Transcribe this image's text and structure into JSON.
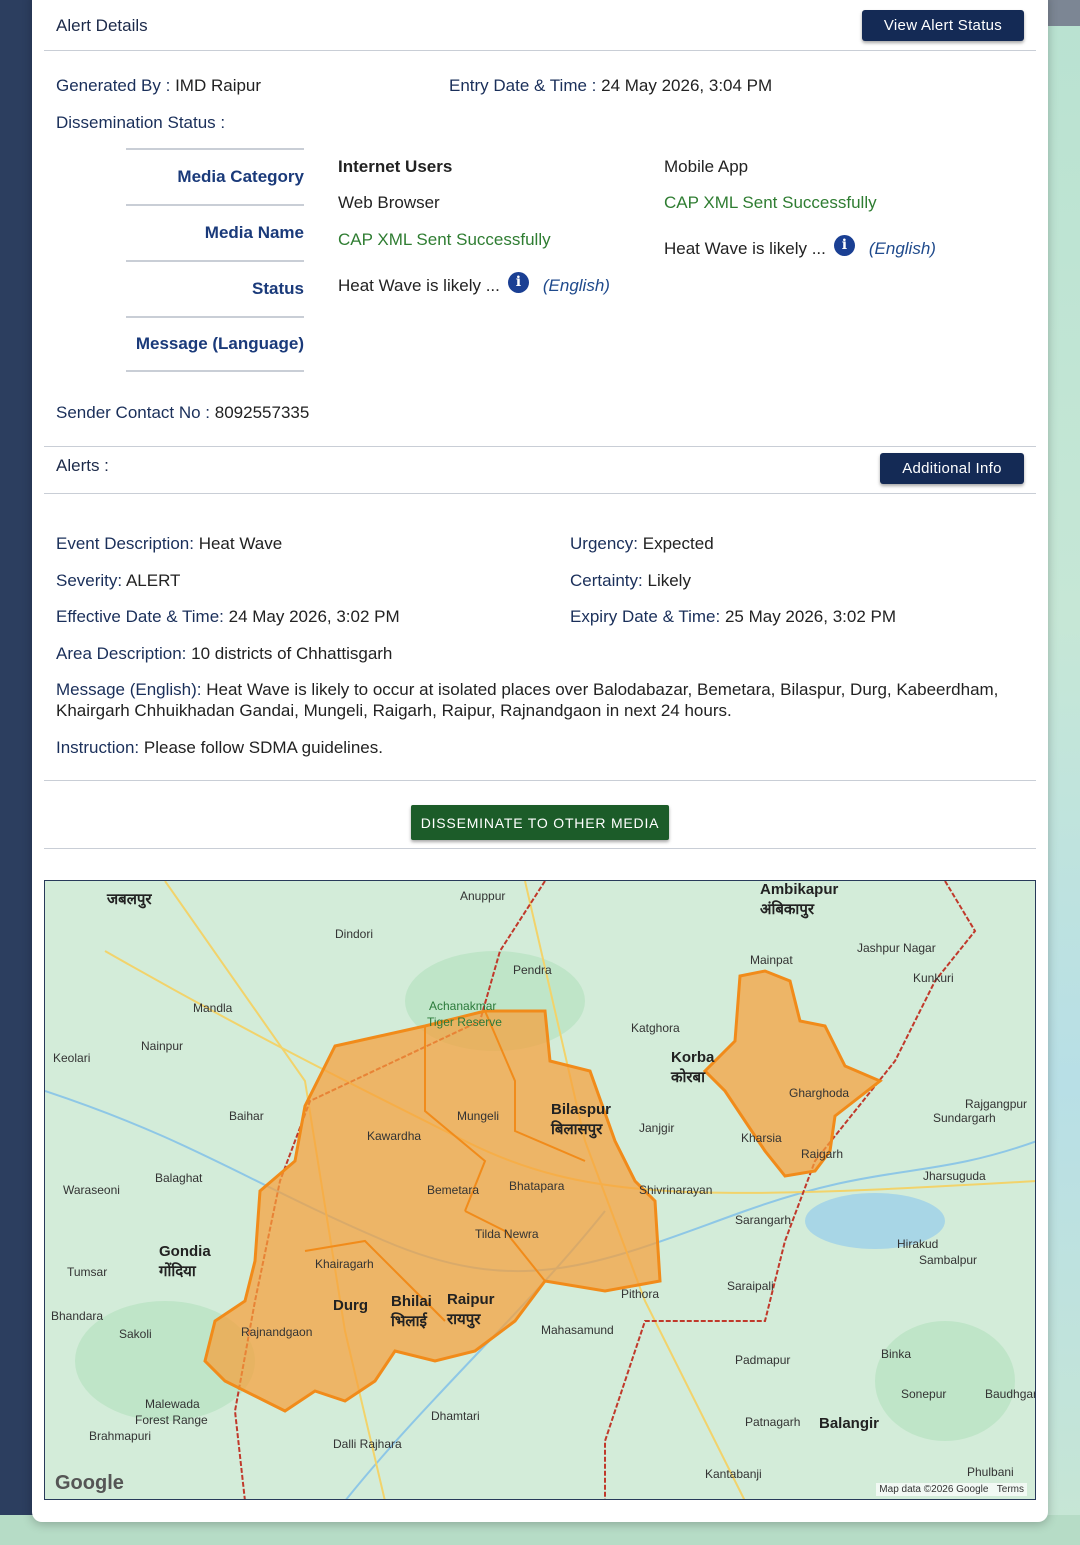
{
  "alert_details": {
    "title": "Alert Details",
    "view_status_label": "View Alert Status",
    "generated_by_label": "Generated By :",
    "generated_by_value": "IMD Raipur",
    "entry_label": "Entry Date & Time :",
    "entry_value": "24 May 2026, 3:04 PM",
    "dissemination_label": "Dissemination Status :",
    "table_headers": [
      "Media Category",
      "Media Name",
      "Status",
      "Message (Language)"
    ],
    "col1": {
      "category": "Internet Users",
      "name": "Web Browser",
      "status": "CAP XML Sent Successfully",
      "message": "Heat Wave is likely ...",
      "language": "(English)"
    },
    "col2": {
      "category": "Mobile App",
      "status": "CAP XML Sent Successfully",
      "message": "Heat Wave is likely ...",
      "language": "(English)"
    },
    "info_glyph": "i",
    "sender_label": "Sender Contact No :",
    "sender_value": "8092557335"
  },
  "alerts": {
    "title": "Alerts :",
    "additional_info_label": "Additional Info",
    "event_label": "Event Description:",
    "event_value": "Heat Wave",
    "urgency_label": "Urgency:",
    "urgency_value": "Expected",
    "severity_label": "Severity:",
    "severity_value": "ALERT",
    "certainty_label": "Certainty:",
    "certainty_value": "Likely",
    "effective_label": "Effective Date & Time:",
    "effective_value": "24 May 2026, 3:02 PM",
    "expiry_label": "Expiry Date & Time:",
    "expiry_value": "25 May 2026, 3:02 PM",
    "area_label": "Area Description:",
    "area_value": "10 districts of Chhattisgarh",
    "message_label": "Message (English):",
    "message_value": "Heat Wave is likely to occur at isolated places over Balodabazar, Bemetara, Bilaspur, Durg, Kabeerdham, Khairgarh Chhuikhadan Gandai, Mungeli, Raigarh, Raipur, Rajnandgaon in next 24 hours.",
    "instruction_label": "Instruction:",
    "instruction_value": "Please follow SDMA guidelines."
  },
  "disseminate_label": "DISSEMINATE TO OTHER MEDIA",
  "map": {
    "labels": [
      "जबलपुर",
      "Anuppur",
      "Ambikapur",
      "अंबिकापुर",
      "Dindori",
      "Pendra",
      "Mainpat",
      "Jashpur Nagar",
      "Kunkuri",
      "Mandla",
      "Nainpur",
      "Keolari",
      "Katghora",
      "Korba",
      "कोरबा",
      "Rajgangpur",
      "Sundargarh",
      "Kawardha",
      "Mungeli",
      "Bilaspur",
      "बिलासपुर",
      "Janjgir",
      "Baihar",
      "Gharghoda",
      "Kharsia",
      "Raigarh",
      "Jharsuguda",
      "Balaghat",
      "Waraseoni",
      "Bemetara",
      "Bhatapara",
      "Shivrinarayan",
      "Sarangarh",
      "Hirakud",
      "Sambalpur",
      "Gondia",
      "गोंदिया",
      "Tumsar",
      "Khairagarh",
      "Tilda Newra",
      "Bhandara",
      "Sakoli",
      "Rajnandgaon",
      "Durg",
      "Bhilai",
      "भिलाई",
      "Raipur",
      "रायपुर",
      "Pithora",
      "Saraipali",
      "Mahasamund",
      "Padmapur",
      "Binka",
      "Sonepur",
      "Baudhgarh",
      "Malewada",
      "Forest Range",
      "Brahmapuri",
      "Dhamtari",
      "Dalli Rajhara",
      "Patnagarh",
      "Balangir",
      "Kantabanji",
      "Phulbani",
      "Achanakmar",
      "Tiger Reserve"
    ],
    "logo": "Google",
    "credit": "Map data ©2026 Google",
    "terms": "Terms"
  }
}
